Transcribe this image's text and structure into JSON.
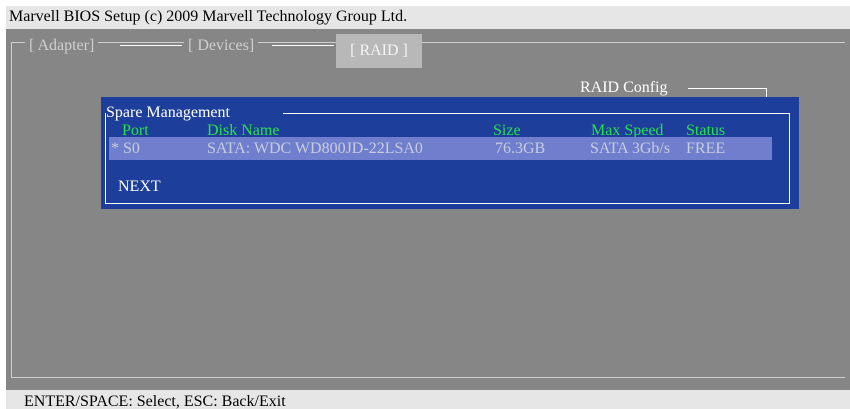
{
  "window": {
    "title": "Marvell BIOS Setup (c) 2009 Marvell Technology Group Ltd."
  },
  "tabs": [
    {
      "label": "[ Adapter]",
      "selected": false
    },
    {
      "label": "[ Devices]",
      "selected": false
    },
    {
      "label": "[  RAID  ]",
      "selected": true
    }
  ],
  "raid_config": {
    "label": "RAID Config"
  },
  "spare_management": {
    "title": "Spare Management",
    "columns": {
      "port": "Port",
      "disk_name": "Disk Name",
      "size": "Size",
      "max_speed": "Max Speed",
      "status": "Status"
    },
    "rows": [
      {
        "port": "* S0",
        "disk_name": "SATA: WDC WD800JD-22LSA0",
        "size": "76.3GB",
        "max_speed": "SATA 3Gb/s",
        "status": "FREE"
      }
    ],
    "next_label": "NEXT"
  },
  "footer": {
    "help": "ENTER/SPACE: Select, ESC: Back/Exit"
  },
  "colors": {
    "background": "#868686",
    "dialog": "#1d3e9a",
    "selected_row": "#6f7fcd",
    "column_header": "#26e14a",
    "bar": "#e6e6e6"
  }
}
